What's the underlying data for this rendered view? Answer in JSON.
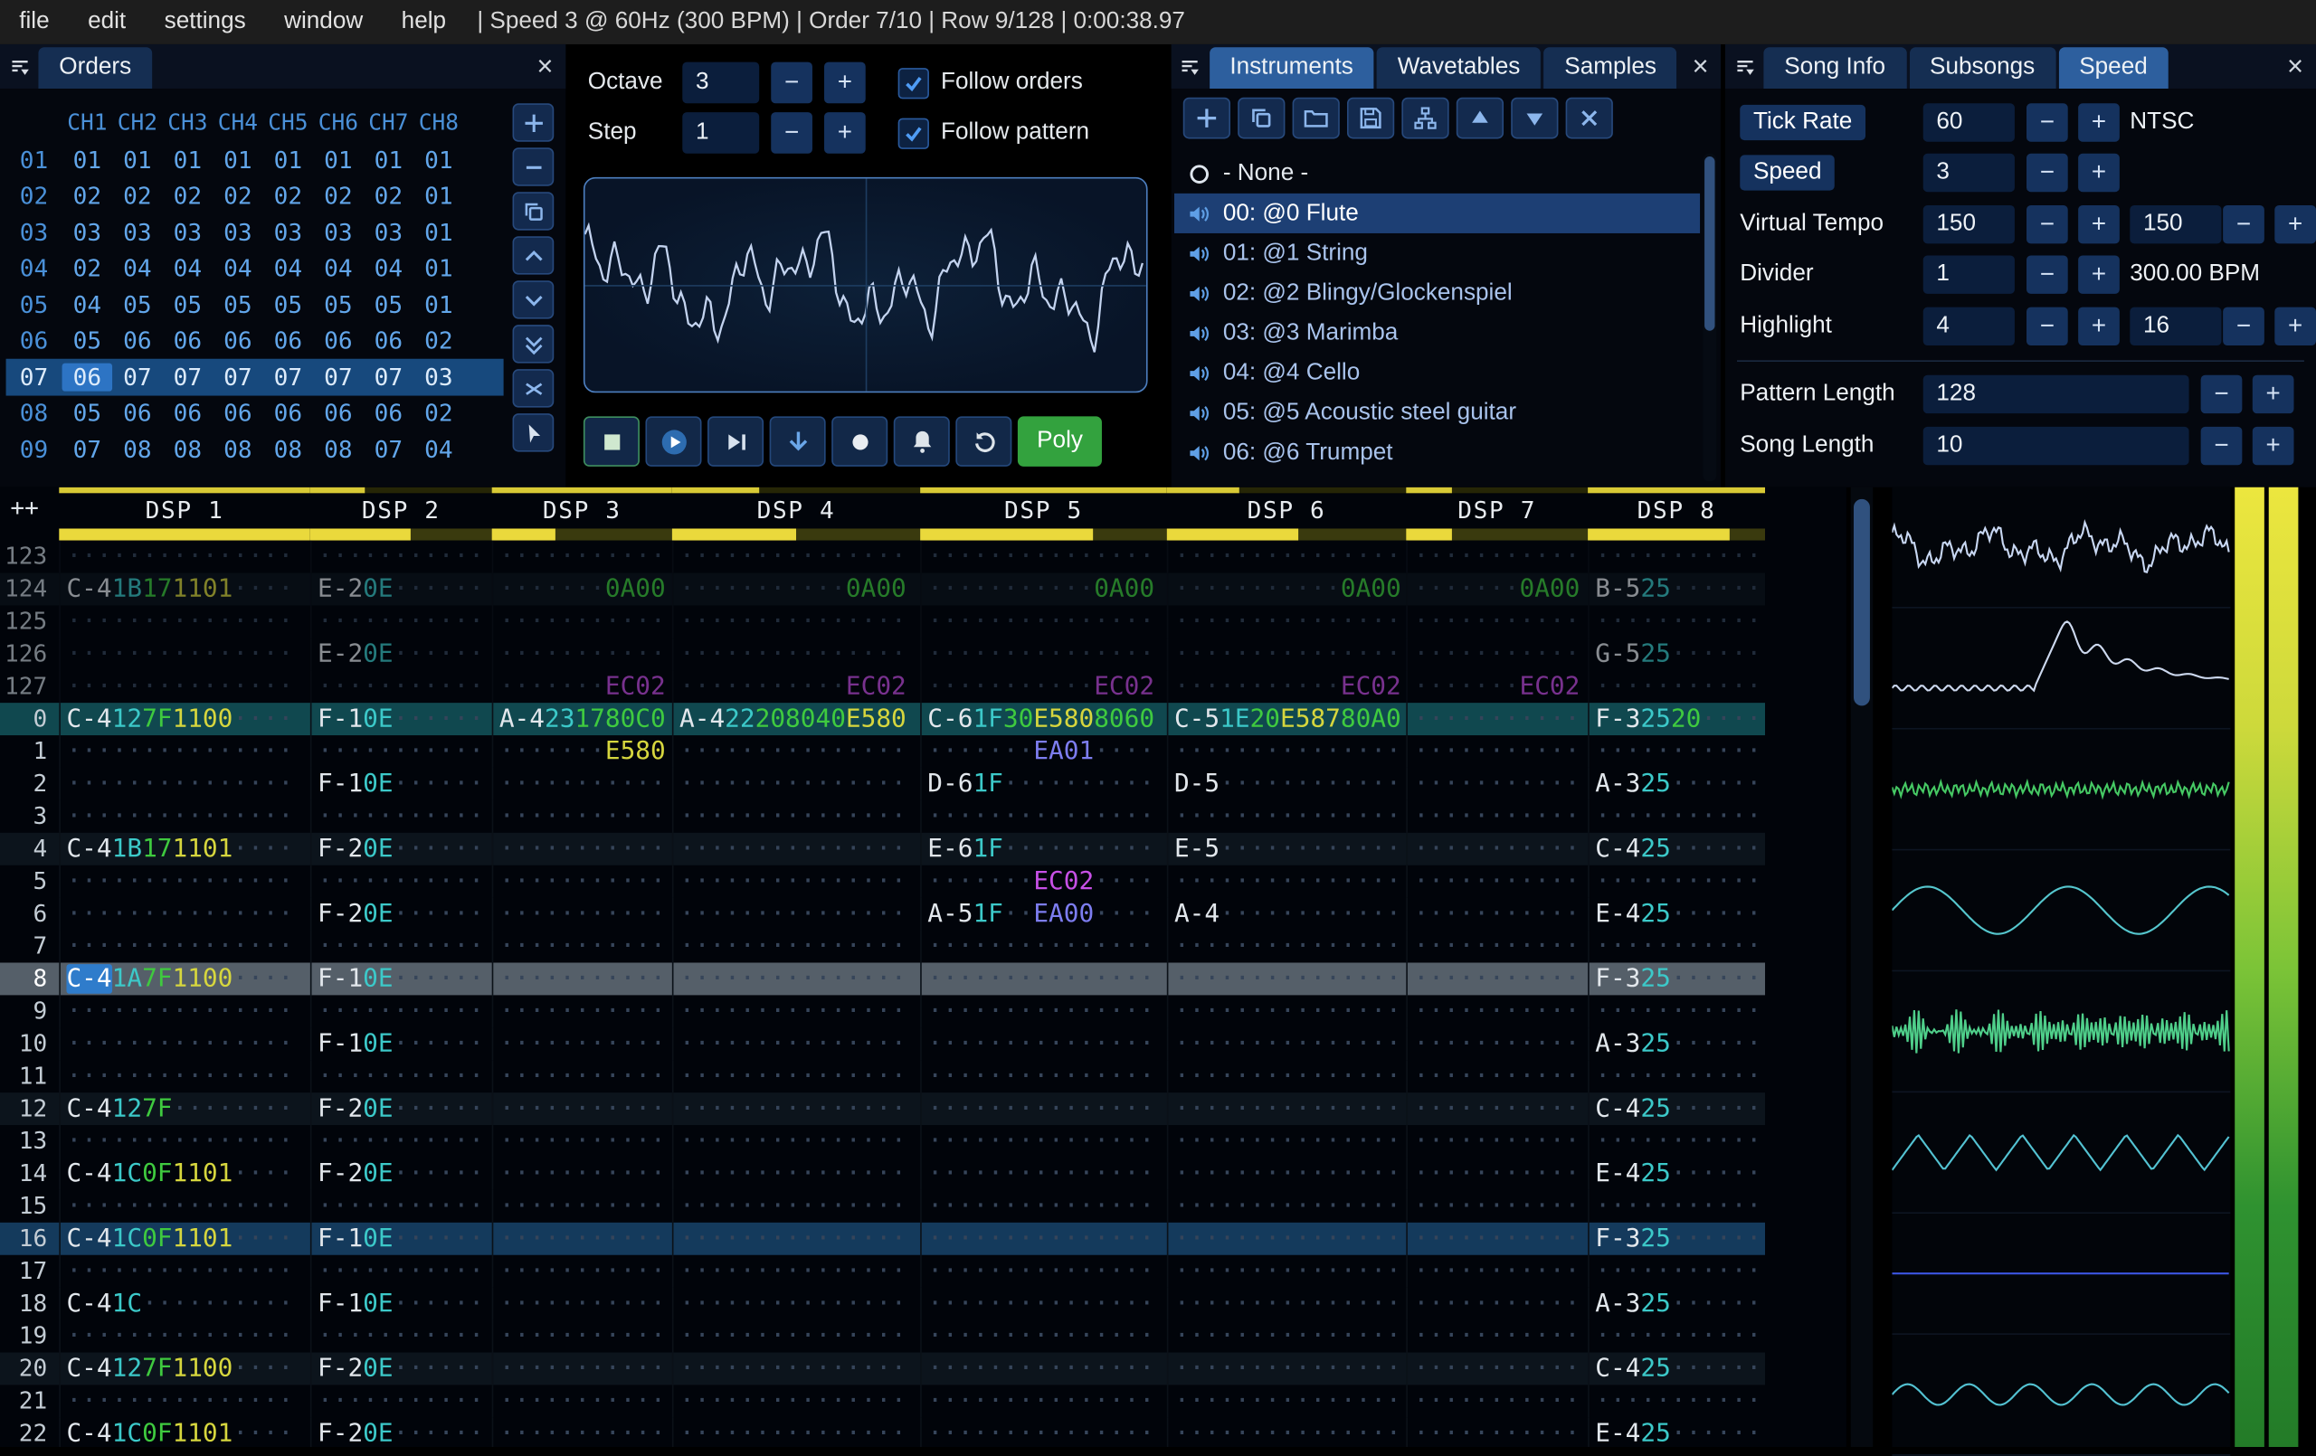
{
  "ui": {
    "minus": "−",
    "plus": "+",
    "close": "×"
  },
  "menu": {
    "items": [
      "file",
      "edit",
      "settings",
      "window",
      "help"
    ],
    "status": "| Speed 3 @ 60Hz (300 BPM) | Order 7/10 | Row 9/128 | 0:00:38.97"
  },
  "orders": {
    "title": "Orders",
    "channels": [
      "CH1",
      "CH2",
      "CH3",
      "CH4",
      "CH5",
      "CH6",
      "CH7",
      "CH8"
    ],
    "selected_row": "07",
    "cursor_col": 0,
    "rows": [
      {
        "id": "01",
        "vals": [
          "01",
          "01",
          "01",
          "01",
          "01",
          "01",
          "01",
          "01"
        ]
      },
      {
        "id": "02",
        "vals": [
          "02",
          "02",
          "02",
          "02",
          "02",
          "02",
          "02",
          "01"
        ]
      },
      {
        "id": "03",
        "vals": [
          "03",
          "03",
          "03",
          "03",
          "03",
          "03",
          "03",
          "01"
        ]
      },
      {
        "id": "04",
        "vals": [
          "02",
          "04",
          "04",
          "04",
          "04",
          "04",
          "04",
          "01"
        ]
      },
      {
        "id": "05",
        "vals": [
          "04",
          "05",
          "05",
          "05",
          "05",
          "05",
          "05",
          "01"
        ]
      },
      {
        "id": "06",
        "vals": [
          "05",
          "06",
          "06",
          "06",
          "06",
          "06",
          "06",
          "02"
        ]
      },
      {
        "id": "07",
        "vals": [
          "06",
          "07",
          "07",
          "07",
          "07",
          "07",
          "07",
          "03"
        ]
      },
      {
        "id": "08",
        "vals": [
          "05",
          "06",
          "06",
          "06",
          "06",
          "06",
          "06",
          "02"
        ]
      },
      {
        "id": "09",
        "vals": [
          "07",
          "08",
          "08",
          "08",
          "08",
          "08",
          "07",
          "04"
        ]
      }
    ]
  },
  "controls": {
    "octave_label": "Octave",
    "octave_value": "3",
    "step_label": "Step",
    "step_value": "1",
    "follow_orders_label": "Follow orders",
    "follow_pattern_label": "Follow pattern",
    "follow_orders_checked": true,
    "follow_pattern_checked": true,
    "poly_label": "Poly"
  },
  "instruments": {
    "tabs": [
      "Instruments",
      "Wavetables",
      "Samples"
    ],
    "active_tab": "Instruments",
    "none_label": "- None -",
    "selected_index": 0,
    "items": [
      "00: @0 Flute",
      "01: @1 String",
      "02: @2 Blingy/Glockenspiel",
      "03: @3 Marimba",
      "04: @4 Cello",
      "05: @5 Acoustic steel guitar",
      "06: @6 Trumpet"
    ]
  },
  "song": {
    "tabs": [
      "Song Info",
      "Subsongs",
      "Speed"
    ],
    "active_tab": "Speed",
    "tick_rate_label": "Tick Rate",
    "tick_rate": "60",
    "tick_rate_standard": "NTSC",
    "speed_label": "Speed",
    "speed": "3",
    "virtual_tempo_label": "Virtual Tempo",
    "virtual_tempo_num": "150",
    "virtual_tempo_den": "150",
    "divider_label": "Divider",
    "divider": "1",
    "bpm": "300.00 BPM",
    "highlight_label": "Highlight",
    "highlight_first": "4",
    "highlight_second": "16",
    "pattern_length_label": "Pattern Length",
    "pattern_length": "128",
    "song_length_label": "Song Length",
    "song_length": "10"
  },
  "pattern": {
    "corner": "++",
    "channels": [
      {
        "name": "DSP 1",
        "top": 1,
        "meter": 1
      },
      {
        "name": "DSP 2",
        "top": 0.3,
        "meter": 0.55
      },
      {
        "name": "DSP 3",
        "top": 1,
        "meter": 0.35
      },
      {
        "name": "DSP 4",
        "top": 0.35,
        "meter": 0.5
      },
      {
        "name": "DSP 5",
        "top": 1,
        "meter": 0.7
      },
      {
        "name": "DSP 6",
        "top": 0.3,
        "meter": 0.55
      },
      {
        "name": "DSP 7",
        "top": 0.25,
        "meter": 0.25
      },
      {
        "name": "DSP 8",
        "top": 1,
        "meter": 0.8
      }
    ],
    "rows": [
      {
        "n": "123",
        "hl": "prev",
        "cells": [
          null,
          null,
          null,
          null,
          null,
          null,
          null,
          null
        ]
      },
      {
        "n": "124",
        "hl": "prev minor",
        "cells": [
          {
            "note": "C-4",
            "ins": "1B",
            "vol": "17",
            "fx": [
              [
                "1101",
                "y"
              ],
              null
            ]
          },
          {
            "note": "E-2",
            "ins": "0E"
          },
          {
            "fx": [
              [
                "0A00",
                "g"
              ]
            ]
          },
          {
            "fx": [
              null,
              [
                "0A00",
                "g"
              ]
            ]
          },
          {
            "fx": [
              null,
              [
                "0A00",
                "g"
              ]
            ]
          },
          {
            "fx": [
              null,
              [
                "0A00",
                "g"
              ]
            ]
          },
          {
            "fx": [
              [
                "0A00",
                "g"
              ]
            ]
          },
          {
            "note": "B-5",
            "ins": "25"
          }
        ]
      },
      {
        "n": "125",
        "hl": "prev",
        "cells": [
          null,
          null,
          null,
          null,
          null,
          null,
          null,
          null
        ]
      },
      {
        "n": "126",
        "hl": "prev",
        "cells": [
          null,
          {
            "note": "E-2",
            "ins": "0E"
          },
          null,
          null,
          null,
          null,
          null,
          {
            "note": "G-5",
            "ins": "25"
          }
        ]
      },
      {
        "n": "127",
        "hl": "prev",
        "cells": [
          null,
          null,
          {
            "fx": [
              [
                "EC02",
                "p"
              ]
            ]
          },
          {
            "fx": [
              null,
              [
                "EC02",
                "p"
              ]
            ]
          },
          {
            "fx": [
              null,
              [
                "EC02",
                "p"
              ]
            ]
          },
          {
            "fx": [
              null,
              [
                "EC02",
                "p"
              ]
            ]
          },
          {
            "fx": [
              [
                "EC02",
                "p"
              ]
            ]
          },
          null
        ]
      },
      {
        "n": "0",
        "hl": "play",
        "cells": [
          {
            "note": "C-4",
            "ins": "12",
            "vol": "7F",
            "fx": [
              [
                "1100",
                "y"
              ],
              null
            ]
          },
          {
            "note": "F-1",
            "ins": "0E"
          },
          {
            "note": "A-4",
            "ins": "23",
            "vol": "17",
            "fx": [
              [
                "80C0",
                "g"
              ]
            ]
          },
          {
            "note": "A-4",
            "ins": "22",
            "vol": "20",
            "fx": [
              [
                "8040",
                "g"
              ],
              [
                "E580",
                "y"
              ]
            ]
          },
          {
            "note": "C-6",
            "ins": "1F",
            "vol": "30",
            "fx": [
              [
                "E580",
                "y"
              ],
              [
                "8060",
                "g"
              ]
            ]
          },
          {
            "note": "C-5",
            "ins": "1E",
            "vol": "20",
            "fx": [
              [
                "E587",
                "y"
              ],
              [
                "80A0",
                "g"
              ]
            ]
          },
          null,
          {
            "note": "F-3",
            "ins": "25",
            "vol": "20"
          }
        ]
      },
      {
        "n": "1",
        "hl": "",
        "cells": [
          null,
          null,
          {
            "fx": [
              [
                "E580",
                "y"
              ]
            ]
          },
          null,
          {
            "fx": [
              [
                "EA01",
                "b"
              ]
            ]
          },
          null,
          null,
          null
        ]
      },
      {
        "n": "2",
        "hl": "",
        "cells": [
          null,
          {
            "note": "F-1",
            "ins": "0E"
          },
          null,
          null,
          {
            "note": "D-6",
            "ins": "1F"
          },
          {
            "note": "D-5"
          },
          null,
          {
            "note": "A-3",
            "ins": "25"
          }
        ]
      },
      {
        "n": "3",
        "hl": "",
        "cells": [
          null,
          null,
          null,
          null,
          null,
          null,
          null,
          null
        ]
      },
      {
        "n": "4",
        "hl": "minor",
        "cells": [
          {
            "note": "C-4",
            "ins": "1B",
            "vol": "17",
            "fx": [
              [
                "1101",
                "y"
              ],
              null
            ]
          },
          {
            "note": "F-2",
            "ins": "0E"
          },
          null,
          null,
          {
            "note": "E-6",
            "ins": "1F"
          },
          {
            "note": "E-5"
          },
          null,
          {
            "note": "C-4",
            "ins": "25"
          }
        ]
      },
      {
        "n": "5",
        "hl": "",
        "cells": [
          null,
          null,
          null,
          null,
          {
            "fx": [
              [
                "EC02",
                "p"
              ]
            ]
          },
          null,
          null,
          null
        ]
      },
      {
        "n": "6",
        "hl": "",
        "cells": [
          null,
          {
            "note": "F-2",
            "ins": "0E"
          },
          null,
          null,
          {
            "note": "A-5",
            "ins": "1F",
            "fx": [
              [
                "EA00",
                "b"
              ]
            ]
          },
          {
            "note": "A-4"
          },
          null,
          {
            "note": "E-4",
            "ins": "25"
          }
        ]
      },
      {
        "n": "7",
        "hl": "",
        "cells": [
          null,
          null,
          null,
          null,
          null,
          null,
          null,
          null
        ]
      },
      {
        "n": "8",
        "hl": "cursor",
        "cells": [
          {
            "note": "C-4",
            "ins": "1A",
            "vol": "7F",
            "fx": [
              [
                "1100",
                "y"
              ],
              null
            ],
            "cur": true
          },
          {
            "note": "F-1",
            "ins": "0E"
          },
          null,
          null,
          null,
          null,
          null,
          {
            "note": "F-3",
            "ins": "25"
          }
        ]
      },
      {
        "n": "9",
        "hl": "",
        "cells": [
          null,
          null,
          null,
          null,
          null,
          null,
          null,
          null
        ]
      },
      {
        "n": "10",
        "hl": "",
        "cells": [
          null,
          {
            "note": "F-1",
            "ins": "0E"
          },
          null,
          null,
          null,
          null,
          null,
          {
            "note": "A-3",
            "ins": "25"
          }
        ]
      },
      {
        "n": "11",
        "hl": "",
        "cells": [
          null,
          null,
          null,
          null,
          null,
          null,
          null,
          null
        ]
      },
      {
        "n": "12",
        "hl": "minor",
        "cells": [
          {
            "note": "C-4",
            "ins": "12",
            "vol": "7F"
          },
          {
            "note": "F-2",
            "ins": "0E"
          },
          null,
          null,
          null,
          null,
          null,
          {
            "note": "C-4",
            "ins": "25"
          }
        ]
      },
      {
        "n": "13",
        "hl": "",
        "cells": [
          null,
          null,
          null,
          null,
          null,
          null,
          null,
          null
        ]
      },
      {
        "n": "14",
        "hl": "",
        "cells": [
          {
            "note": "C-4",
            "ins": "1C",
            "vol": "0F",
            "fx": [
              [
                "1101",
                "y"
              ],
              null
            ]
          },
          {
            "note": "F-2",
            "ins": "0E"
          },
          null,
          null,
          null,
          null,
          null,
          {
            "note": "E-4",
            "ins": "25"
          }
        ]
      },
      {
        "n": "15",
        "hl": "",
        "cells": [
          null,
          null,
          null,
          null,
          null,
          null,
          null,
          null
        ]
      },
      {
        "n": "16",
        "hl": "major",
        "cells": [
          {
            "note": "C-4",
            "ins": "1C",
            "vol": "0F",
            "fx": [
              [
                "1101",
                "y"
              ],
              null
            ]
          },
          {
            "note": "F-1",
            "ins": "0E"
          },
          null,
          null,
          null,
          null,
          null,
          {
            "note": "F-3",
            "ins": "25"
          }
        ]
      },
      {
        "n": "17",
        "hl": "",
        "cells": [
          null,
          null,
          null,
          null,
          null,
          null,
          null,
          null
        ]
      },
      {
        "n": "18",
        "hl": "",
        "cells": [
          {
            "note": "C-4",
            "ins": "1C"
          },
          {
            "note": "F-1",
            "ins": "0E"
          },
          null,
          null,
          null,
          null,
          null,
          {
            "note": "A-3",
            "ins": "25"
          }
        ]
      },
      {
        "n": "19",
        "hl": "",
        "cells": [
          null,
          null,
          null,
          null,
          null,
          null,
          null,
          null
        ]
      },
      {
        "n": "20",
        "hl": "minor",
        "cells": [
          {
            "note": "C-4",
            "ins": "12",
            "vol": "7F",
            "fx": [
              [
                "1100",
                "y"
              ],
              null
            ]
          },
          {
            "note": "F-2",
            "ins": "0E"
          },
          null,
          null,
          null,
          null,
          null,
          {
            "note": "C-4",
            "ins": "25"
          }
        ]
      },
      {
        "n": "21",
        "hl": "",
        "cells": [
          null,
          null,
          null,
          null,
          null,
          null,
          null,
          null
        ]
      },
      {
        "n": "22",
        "hl": "",
        "cells": [
          {
            "note": "C-4",
            "ins": "1C",
            "vol": "0F",
            "fx": [
              [
                "1101",
                "y"
              ],
              null
            ]
          },
          {
            "note": "F-2",
            "ins": "0E"
          },
          null,
          null,
          null,
          null,
          null,
          {
            "note": "E-4",
            "ins": "25"
          }
        ]
      }
    ]
  },
  "scopes": [
    {
      "type": "noise",
      "color": "#c8d7f2",
      "amp": 15,
      "freq": 1
    },
    {
      "type": "envelope",
      "color": "#ccd8ee",
      "amp": 30,
      "freq": 1
    },
    {
      "type": "dense",
      "color": "#46c964",
      "amp": 5,
      "freq": 2.9
    },
    {
      "type": "sine",
      "color": "#55c6cd",
      "amp": 16,
      "freq": 2.4
    },
    {
      "type": "dense",
      "color": "#4fcf8a",
      "amp": 15,
      "freq": 2.2
    },
    {
      "type": "zigzag",
      "color": "#53c2d2",
      "amp": 12,
      "freq": 6.5
    },
    {
      "type": "flat",
      "color": "#3c55e2",
      "amp": 0,
      "freq": 0
    },
    {
      "type": "sine",
      "color": "#53c2d2",
      "amp": 7,
      "freq": 5.5
    }
  ],
  "meter_gradient": [
    "#ece63e",
    "#cdd93b",
    "#7cc437",
    "#2f9230",
    "#237b28"
  ]
}
